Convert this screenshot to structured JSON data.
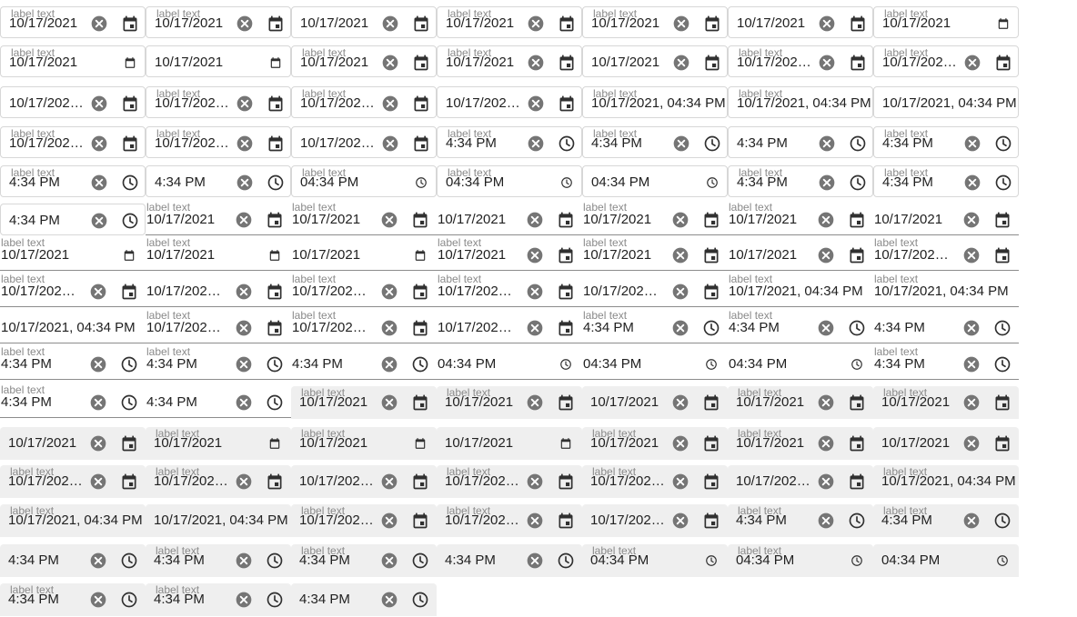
{
  "defaults": {
    "label": "label text",
    "date": "10/17/2021",
    "date_truncated": "10/17/202…",
    "datetime": "10/17/2021, 04:34 PM",
    "datetime_truncated": "10/17/2021, …",
    "time": "4:34 PM",
    "time_native": "04:34 PM"
  },
  "rows": [
    {
      "variant": "outlined",
      "cells": [
        {
          "label": true,
          "value": "10/17/2021",
          "clear": true,
          "icon": "calendar"
        },
        {
          "label": true,
          "value": "10/17/2021",
          "clear": true,
          "icon": "calendar"
        },
        {
          "label": false,
          "value": "10/17/2021",
          "clear": true,
          "icon": "calendar"
        },
        {
          "label": true,
          "value": "10/17/2021",
          "clear": true,
          "icon": "calendar"
        },
        {
          "label": true,
          "value": "10/17/2021",
          "clear": true,
          "icon": "calendar"
        },
        {
          "label": false,
          "value": "10/17/2021",
          "clear": true,
          "icon": "calendar"
        },
        {
          "label": true,
          "value": "10/17/2021",
          "clear": false,
          "icon": "calendar-native"
        }
      ]
    },
    {
      "variant": "outlined",
      "cells": [
        {
          "label": true,
          "value": "10/17/2021",
          "clear": false,
          "icon": "calendar-native"
        },
        {
          "label": false,
          "value": "10/17/2021",
          "clear": false,
          "icon": "calendar-native"
        },
        {
          "label": true,
          "value": "10/17/2021",
          "clear": true,
          "icon": "calendar"
        },
        {
          "label": true,
          "value": "10/17/2021",
          "clear": true,
          "icon": "calendar"
        },
        {
          "label": false,
          "value": "10/17/2021",
          "clear": true,
          "icon": "calendar"
        },
        {
          "label": true,
          "value": "10/17/202…",
          "clear": true,
          "icon": "calendar"
        },
        {
          "label": true,
          "value": "10/17/202…",
          "clear": true,
          "icon": "calendar"
        }
      ]
    },
    {
      "variant": "outlined",
      "cells": [
        {
          "label": false,
          "value": "10/17/202…",
          "clear": true,
          "icon": "calendar"
        },
        {
          "label": true,
          "value": "10/17/202…",
          "clear": true,
          "icon": "calendar"
        },
        {
          "label": true,
          "value": "10/17/202…",
          "clear": true,
          "icon": "calendar"
        },
        {
          "label": false,
          "value": "10/17/202…",
          "clear": true,
          "icon": "calendar"
        },
        {
          "label": true,
          "value": "10/17/2021, 04:34 PM",
          "clear": false,
          "icon": null
        },
        {
          "label": true,
          "value": "10/17/2021, 04:34 PM",
          "clear": false,
          "icon": null
        },
        {
          "label": false,
          "value": "10/17/2021, 04:34 PM",
          "clear": false,
          "icon": null
        }
      ]
    },
    {
      "variant": "outlined",
      "cells": [
        {
          "label": true,
          "value": "10/17/202…",
          "clear": true,
          "icon": "calendar"
        },
        {
          "label": true,
          "value": "10/17/202…",
          "clear": true,
          "icon": "calendar"
        },
        {
          "label": false,
          "value": "10/17/202…",
          "clear": true,
          "icon": "calendar"
        },
        {
          "label": true,
          "value": "4:34 PM",
          "clear": true,
          "icon": "clock"
        },
        {
          "label": true,
          "value": "4:34 PM",
          "clear": true,
          "icon": "clock"
        },
        {
          "label": false,
          "value": "4:34 PM",
          "clear": true,
          "icon": "clock"
        },
        {
          "label": true,
          "value": "4:34 PM",
          "clear": true,
          "icon": "clock"
        }
      ]
    },
    {
      "variant": "outlined",
      "cells": [
        {
          "label": true,
          "value": "4:34 PM",
          "clear": true,
          "icon": "clock"
        },
        {
          "label": false,
          "value": "4:34 PM",
          "clear": true,
          "icon": "clock"
        },
        {
          "label": true,
          "value": "04:34 PM",
          "clear": false,
          "icon": "clock-native"
        },
        {
          "label": true,
          "value": "04:34 PM",
          "clear": false,
          "icon": "clock-native"
        },
        {
          "label": false,
          "value": "04:34 PM",
          "clear": false,
          "icon": "clock-native"
        },
        {
          "label": true,
          "value": "4:34 PM",
          "clear": true,
          "icon": "clock"
        },
        {
          "label": true,
          "value": "4:34 PM",
          "clear": true,
          "icon": "clock"
        }
      ]
    },
    {
      "variant": "mixed",
      "cells": [
        {
          "variant": "outlined",
          "label": false,
          "value": "4:34 PM",
          "clear": true,
          "icon": "clock"
        },
        {
          "variant": "standard",
          "label": true,
          "value": "10/17/2021",
          "clear": true,
          "icon": "calendar"
        },
        {
          "variant": "standard",
          "label": true,
          "value": "10/17/2021",
          "clear": true,
          "icon": "calendar"
        },
        {
          "variant": "standard",
          "label": false,
          "value": "10/17/2021",
          "clear": true,
          "icon": "calendar"
        },
        {
          "variant": "standard",
          "label": true,
          "value": "10/17/2021",
          "clear": true,
          "icon": "calendar"
        },
        {
          "variant": "standard",
          "label": true,
          "value": "10/17/2021",
          "clear": true,
          "icon": "calendar"
        },
        {
          "variant": "standard",
          "label": false,
          "value": "10/17/2021",
          "clear": true,
          "icon": "calendar"
        }
      ]
    },
    {
      "variant": "standard",
      "cells": [
        {
          "label": true,
          "value": "10/17/2021",
          "clear": false,
          "icon": "calendar-native"
        },
        {
          "label": true,
          "value": "10/17/2021",
          "clear": false,
          "icon": "calendar-native"
        },
        {
          "label": false,
          "value": "10/17/2021",
          "clear": false,
          "icon": "calendar-native"
        },
        {
          "label": true,
          "value": "10/17/2021",
          "clear": true,
          "icon": "calendar"
        },
        {
          "label": true,
          "value": "10/17/2021",
          "clear": true,
          "icon": "calendar"
        },
        {
          "label": false,
          "value": "10/17/2021",
          "clear": true,
          "icon": "calendar"
        },
        {
          "label": true,
          "value": "10/17/2021, …",
          "clear": true,
          "icon": "calendar"
        }
      ]
    },
    {
      "variant": "standard",
      "cells": [
        {
          "label": true,
          "value": "10/17/2021, …",
          "clear": true,
          "icon": "calendar"
        },
        {
          "label": false,
          "value": "10/17/2021, …",
          "clear": true,
          "icon": "calendar"
        },
        {
          "label": true,
          "value": "10/17/2021, …",
          "clear": true,
          "icon": "calendar"
        },
        {
          "label": true,
          "value": "10/17/2021, …",
          "clear": true,
          "icon": "calendar"
        },
        {
          "label": false,
          "value": "10/17/2021, …",
          "clear": true,
          "icon": "calendar"
        },
        {
          "label": true,
          "value": "10/17/2021, 04:34 PM",
          "clear": false,
          "icon": null
        },
        {
          "label": true,
          "value": "10/17/2021, 04:34 PM",
          "clear": false,
          "icon": null
        }
      ]
    },
    {
      "variant": "standard",
      "cells": [
        {
          "label": false,
          "value": "10/17/2021, 04:34 PM",
          "clear": false,
          "icon": null
        },
        {
          "label": true,
          "value": "10/17/2021, …",
          "clear": true,
          "icon": "calendar"
        },
        {
          "label": true,
          "value": "10/17/2021, …",
          "clear": true,
          "icon": "calendar"
        },
        {
          "label": false,
          "value": "10/17/2021, …",
          "clear": true,
          "icon": "calendar"
        },
        {
          "label": true,
          "value": "4:34 PM",
          "clear": true,
          "icon": "clock"
        },
        {
          "label": true,
          "value": "4:34 PM",
          "clear": true,
          "icon": "clock"
        },
        {
          "label": false,
          "value": "4:34 PM",
          "clear": true,
          "icon": "clock"
        }
      ]
    },
    {
      "variant": "standard",
      "cells": [
        {
          "label": true,
          "value": "4:34 PM",
          "clear": true,
          "icon": "clock"
        },
        {
          "label": true,
          "value": "4:34 PM",
          "clear": true,
          "icon": "clock"
        },
        {
          "label": false,
          "value": "4:34 PM",
          "clear": true,
          "icon": "clock"
        },
        {
          "label": false,
          "value": "04:34 PM",
          "clear": false,
          "icon": "clock-native"
        },
        {
          "label": false,
          "value": "04:34 PM",
          "clear": false,
          "icon": "clock-native"
        },
        {
          "label": false,
          "value": "04:34 PM",
          "clear": false,
          "icon": "clock-native"
        },
        {
          "label": true,
          "value": "4:34 PM",
          "clear": true,
          "icon": "clock"
        }
      ]
    },
    {
      "variant": "mixed",
      "cells": [
        {
          "variant": "standard",
          "label": true,
          "value": "4:34 PM",
          "clear": true,
          "icon": "clock"
        },
        {
          "variant": "standard",
          "label": false,
          "value": "4:34 PM",
          "clear": true,
          "icon": "clock"
        },
        {
          "variant": "filled",
          "label": true,
          "value": "10/17/2021",
          "clear": true,
          "icon": "calendar"
        },
        {
          "variant": "filled",
          "label": true,
          "value": "10/17/2021",
          "clear": true,
          "icon": "calendar"
        },
        {
          "variant": "filled",
          "label": false,
          "value": "10/17/2021",
          "clear": true,
          "icon": "calendar"
        },
        {
          "variant": "filled",
          "label": true,
          "value": "10/17/2021",
          "clear": true,
          "icon": "calendar"
        },
        {
          "variant": "filled",
          "label": true,
          "value": "10/17/2021",
          "clear": true,
          "icon": "calendar"
        }
      ]
    },
    {
      "variant": "filled",
      "cells": [
        {
          "label": false,
          "value": "10/17/2021",
          "clear": true,
          "icon": "calendar"
        },
        {
          "label": true,
          "value": "10/17/2021",
          "clear": false,
          "icon": "calendar-native"
        },
        {
          "label": true,
          "value": "10/17/2021",
          "clear": false,
          "icon": "calendar-native"
        },
        {
          "label": false,
          "value": "10/17/2021",
          "clear": false,
          "icon": "calendar-native"
        },
        {
          "label": true,
          "value": "10/17/2021",
          "clear": true,
          "icon": "calendar"
        },
        {
          "label": true,
          "value": "10/17/2021",
          "clear": true,
          "icon": "calendar"
        },
        {
          "label": false,
          "value": "10/17/2021",
          "clear": true,
          "icon": "calendar"
        }
      ]
    },
    {
      "variant": "filled",
      "cells": [
        {
          "label": true,
          "value": "10/17/202…",
          "clear": true,
          "icon": "calendar"
        },
        {
          "label": true,
          "value": "10/17/202…",
          "clear": true,
          "icon": "calendar"
        },
        {
          "label": false,
          "value": "10/17/202…",
          "clear": true,
          "icon": "calendar"
        },
        {
          "label": true,
          "value": "10/17/202…",
          "clear": true,
          "icon": "calendar"
        },
        {
          "label": true,
          "value": "10/17/202…",
          "clear": true,
          "icon": "calendar"
        },
        {
          "label": false,
          "value": "10/17/202…",
          "clear": true,
          "icon": "calendar"
        },
        {
          "label": true,
          "value": "10/17/2021, 04:34 PM",
          "clear": false,
          "icon": null
        }
      ]
    },
    {
      "variant": "filled",
      "cells": [
        {
          "label": true,
          "value": "10/17/2021, 04:34 PM",
          "clear": false,
          "icon": null
        },
        {
          "label": false,
          "value": "10/17/2021, 04:34 PM",
          "clear": false,
          "icon": null
        },
        {
          "label": true,
          "value": "10/17/202…",
          "clear": true,
          "icon": "calendar"
        },
        {
          "label": true,
          "value": "10/17/202…",
          "clear": true,
          "icon": "calendar"
        },
        {
          "label": false,
          "value": "10/17/202…",
          "clear": true,
          "icon": "calendar"
        },
        {
          "label": true,
          "value": "4:34 PM",
          "clear": true,
          "icon": "clock"
        },
        {
          "label": true,
          "value": "4:34 PM",
          "clear": true,
          "icon": "clock"
        }
      ]
    },
    {
      "variant": "filled",
      "cells": [
        {
          "label": false,
          "value": "4:34 PM",
          "clear": true,
          "icon": "clock"
        },
        {
          "label": true,
          "value": "4:34 PM",
          "clear": true,
          "icon": "clock"
        },
        {
          "label": true,
          "value": "4:34 PM",
          "clear": true,
          "icon": "clock"
        },
        {
          "label": false,
          "value": "4:34 PM",
          "clear": true,
          "icon": "clock"
        },
        {
          "label": true,
          "value": "04:34 PM",
          "clear": false,
          "icon": "clock-native"
        },
        {
          "label": true,
          "value": "04:34 PM",
          "clear": false,
          "icon": "clock-native"
        },
        {
          "label": false,
          "value": "04:34 PM",
          "clear": false,
          "icon": "clock-native"
        }
      ]
    },
    {
      "variant": "filled",
      "cells": [
        {
          "label": true,
          "value": "4:34 PM",
          "clear": true,
          "icon": "clock"
        },
        {
          "label": true,
          "value": "4:34 PM",
          "clear": true,
          "icon": "clock"
        },
        {
          "label": false,
          "value": "4:34 PM",
          "clear": true,
          "icon": "clock"
        }
      ]
    }
  ]
}
